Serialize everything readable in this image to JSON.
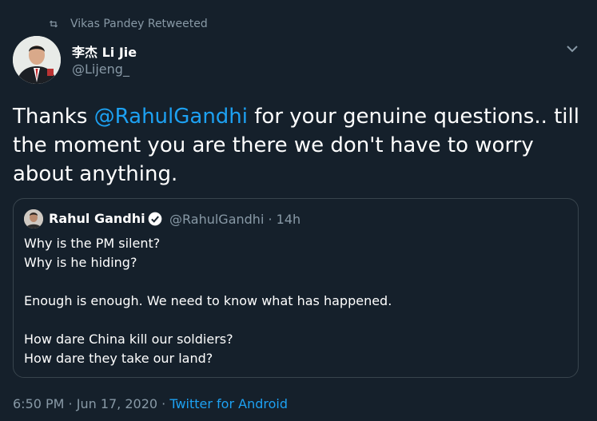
{
  "retweet": {
    "label": "Vikas Pandey Retweeted"
  },
  "author": {
    "name": "李杰 Li Jie",
    "handle": "@Lijeng_"
  },
  "tweet": {
    "text_before": "Thanks ",
    "mention": "@RahulGandhi",
    "text_after": " for your genuine questions.. till the moment you are there we don't have to worry about anything."
  },
  "quoted": {
    "name": "Rahul Gandhi",
    "handle_time": "@RahulGandhi · 14h",
    "lines": {
      "l1": "Why is the PM silent?",
      "l2": "Why is he hiding?",
      "l3": "Enough is enough. We need to know what has happened.",
      "l4": "How dare China kill our soldiers?",
      "l5": "How dare they take our land?"
    }
  },
  "meta": {
    "time_date": "6:50 PM · Jun 17, 2020 · ",
    "source": "Twitter for Android"
  },
  "colors": {
    "background": "#15202b",
    "link": "#1da1f2",
    "secondary_text": "#8899a6",
    "border": "#38444d"
  },
  "icons": {
    "retweet": "retweet-icon",
    "more": "chevron-down-icon",
    "verified": "verified-badge-icon"
  }
}
